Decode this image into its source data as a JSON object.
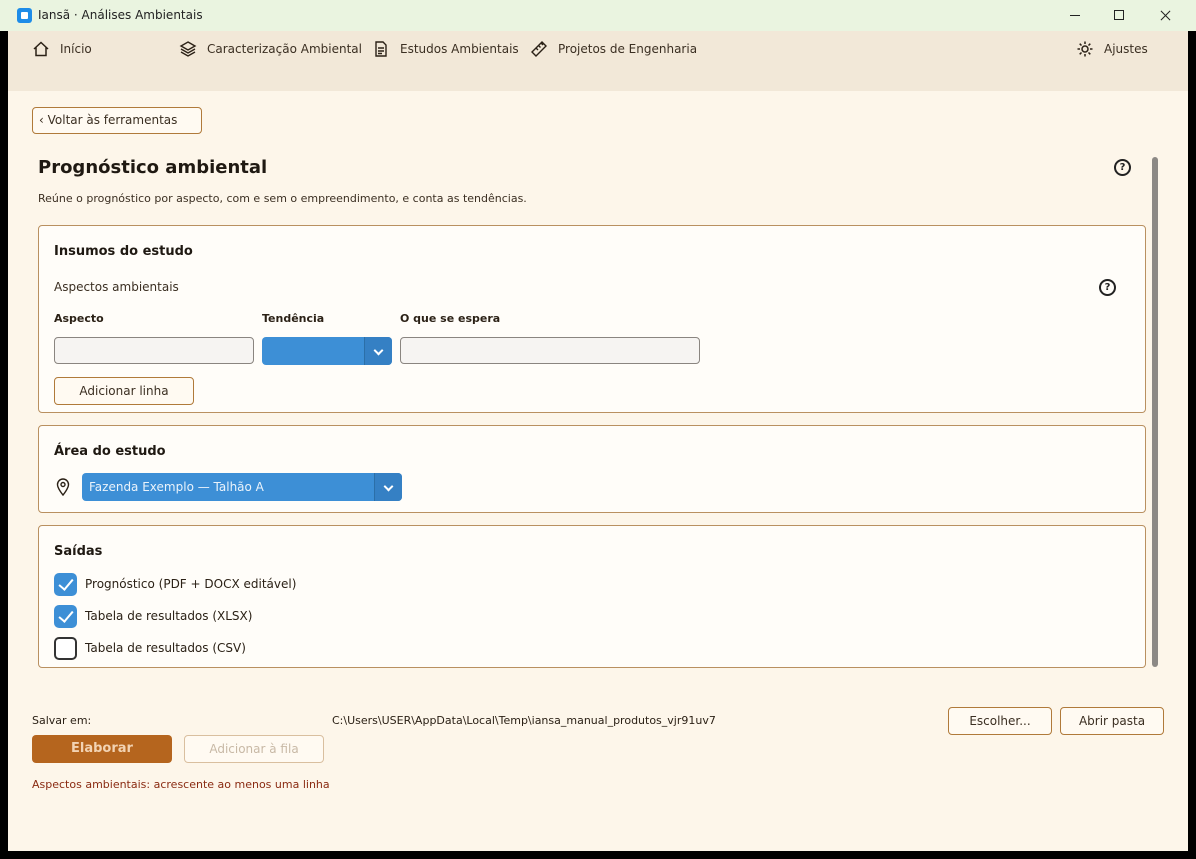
{
  "window": {
    "title": "Iansã · Análises Ambientais"
  },
  "nav": {
    "items": [
      {
        "label": "Início",
        "icon": "home-icon"
      },
      {
        "label": "Caracterização Ambiental",
        "icon": "layers-icon"
      },
      {
        "label": "Estudos Ambientais",
        "icon": "document-icon"
      },
      {
        "label": "Projetos de Engenharia",
        "icon": "ruler-icon"
      }
    ],
    "settings": {
      "label": "Ajustes",
      "icon": "gear-icon"
    }
  },
  "back_button": "‹ Voltar às ferramentas",
  "page": {
    "title": "Prognóstico ambiental",
    "description": "Reúne o prognóstico por aspecto, com e sem o empreendimento, e conta as tendências."
  },
  "inputs_card": {
    "title": "Insumos do estudo",
    "subtitle": "Aspectos ambientais",
    "columns": {
      "aspect": "Aspecto",
      "trend": "Tendência",
      "expected": "O que se espera"
    },
    "row": {
      "aspect": "",
      "trend": "",
      "expected": ""
    },
    "add_row": "Adicionar linha"
  },
  "area_card": {
    "title": "Área do estudo",
    "selected": "Fazenda Exemplo — Talhão A"
  },
  "outputs_card": {
    "title": "Saídas",
    "options": [
      {
        "label": "Prognóstico (PDF + DOCX editável)",
        "checked": true
      },
      {
        "label": "Tabela de resultados (XLSX)",
        "checked": true
      },
      {
        "label": "Tabela de resultados (CSV)",
        "checked": false
      }
    ]
  },
  "footer": {
    "save_label": "Salvar em:",
    "save_path": "C:\\Users\\USER\\AppData\\Local\\Temp\\iansa_manual_produtos_vjr91uv7",
    "choose": "Escolher...",
    "open_folder": "Abrir pasta",
    "elaborate": "Elaborar",
    "enqueue": "Adicionar à fila",
    "error": "Aspectos ambientais: acrescente ao menos uma linha"
  },
  "colors": {
    "accent": "#3d8fd6",
    "primary_button": "#b5651e",
    "background": "#fdf6ea",
    "nav_background": "#f2e8d8",
    "error": "#8a2b12"
  }
}
